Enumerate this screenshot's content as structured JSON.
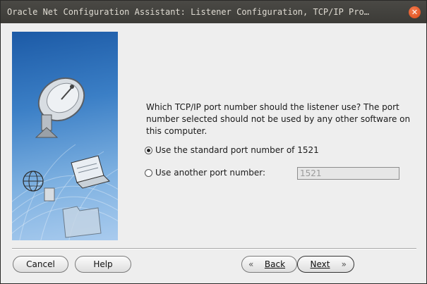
{
  "window": {
    "title": "Oracle Net Configuration Assistant: Listener Configuration, TCP/IP Pro…",
    "close_glyph": "✕"
  },
  "content": {
    "question": "Which TCP/IP port number should the listener use? The port number selected should not be used by any other software on this computer.",
    "options": [
      {
        "label": "Use the standard port number of 1521",
        "selected": true
      },
      {
        "label": "Use another port number:",
        "selected": false
      }
    ],
    "port_value": "1521"
  },
  "buttons": {
    "cancel": "Cancel",
    "help": "Help",
    "back": "Back",
    "next": "Next"
  },
  "icons": {
    "side": [
      "satellite-dish-icon",
      "globe-icon",
      "laptop-icon",
      "folder-icon"
    ],
    "back_arrow": "«",
    "next_arrow": "»"
  },
  "colors": {
    "titlebar": "#3c3b37",
    "close_button": "#df4a16",
    "side_panel": "#3b7fc6",
    "dialog_bg": "#eeeeee"
  }
}
